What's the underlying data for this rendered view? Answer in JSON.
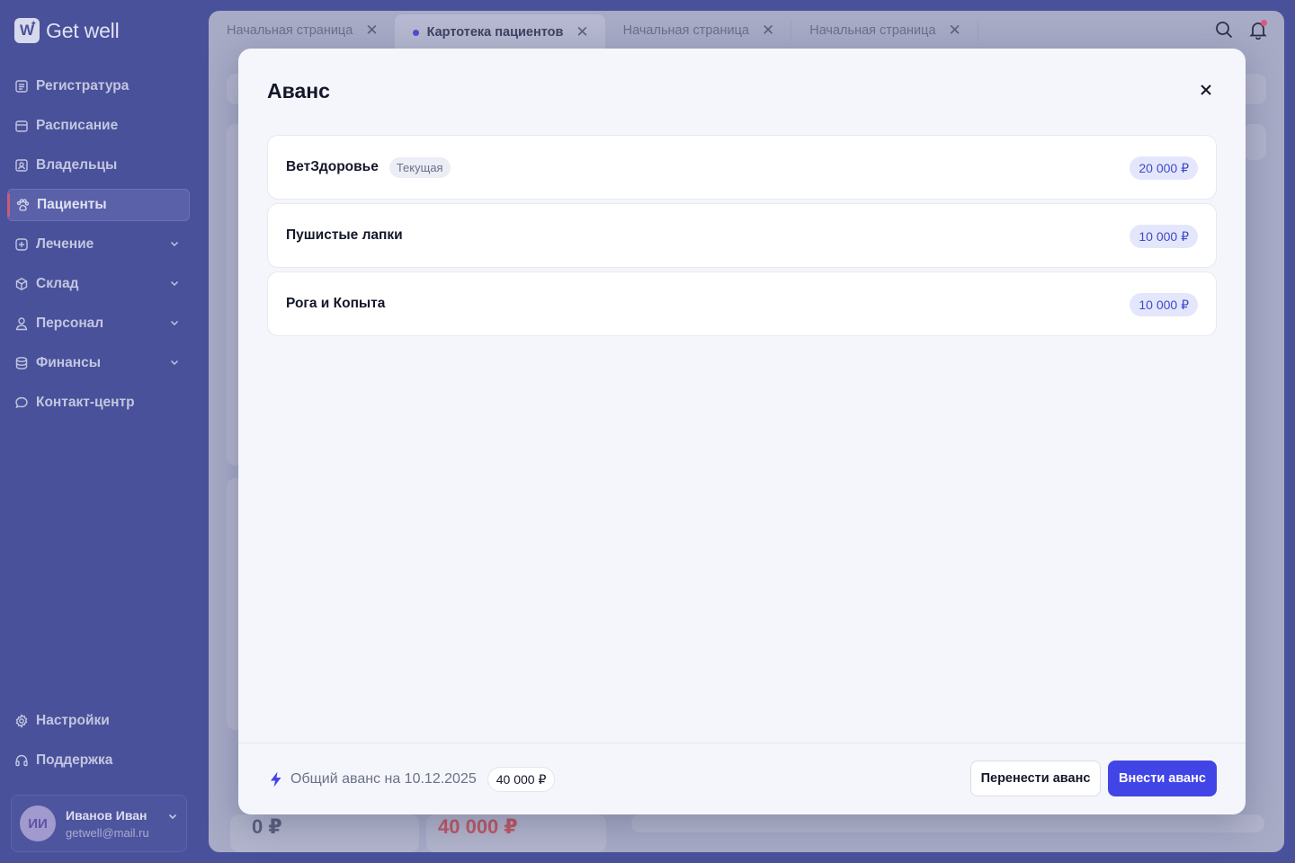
{
  "app": {
    "logo_text": "Get well",
    "logo_mark": "W"
  },
  "sidebar": {
    "items": [
      {
        "label": "Регистратура",
        "icon": "list-icon",
        "active": false,
        "expandable": false
      },
      {
        "label": "Расписание",
        "icon": "calendar-icon",
        "active": false,
        "expandable": false
      },
      {
        "label": "Владельцы",
        "icon": "contacts-icon",
        "active": false,
        "expandable": false
      },
      {
        "label": "Пациенты",
        "icon": "paw-icon",
        "active": true,
        "expandable": false
      },
      {
        "label": "Лечение",
        "icon": "plus-square-icon",
        "active": false,
        "expandable": true
      },
      {
        "label": "Склад",
        "icon": "box-icon",
        "active": false,
        "expandable": true
      },
      {
        "label": "Персонал",
        "icon": "user-icon",
        "active": false,
        "expandable": true
      },
      {
        "label": "Финансы",
        "icon": "coins-icon",
        "active": false,
        "expandable": true
      },
      {
        "label": "Контакт-центр",
        "icon": "chat-icon",
        "active": false,
        "expandable": false
      }
    ],
    "bottom_items": [
      {
        "label": "Настройки",
        "icon": "gear-icon"
      },
      {
        "label": "Поддержка",
        "icon": "headset-icon"
      }
    ],
    "user": {
      "initials": "ИИ",
      "name": "Иванов Иван",
      "email": "getwell@mail.ru"
    }
  },
  "tabs": [
    {
      "label": "Начальная страница",
      "active": false
    },
    {
      "label": "Картотека пациентов",
      "active": true
    },
    {
      "label": "Начальная страница",
      "active": false
    },
    {
      "label": "Начальная страница",
      "active": false
    }
  ],
  "background": {
    "amount_left": "0 ₽",
    "amount_right": "40 000 ₽"
  },
  "modal": {
    "title": "Аванс",
    "clinics": [
      {
        "name": "ВетЗдоровье",
        "badge": "Текущая",
        "amount": "20 000 ₽"
      },
      {
        "name": "Пушистые лапки",
        "badge": "",
        "amount": "10 000 ₽"
      },
      {
        "name": "Рога и Копыта",
        "badge": "",
        "amount": "10 000 ₽"
      }
    ],
    "footer": {
      "total_label": "Общий аванс на 10.12.2025",
      "total_amount": "40 000 ₽",
      "transfer_button": "Перенести аванс",
      "deposit_button": "Внести аванс"
    }
  },
  "colors": {
    "sidebar_bg": "#49519a",
    "accent": "#4245e6",
    "active_marker": "#c85c7c",
    "negative": "#d9534f"
  }
}
